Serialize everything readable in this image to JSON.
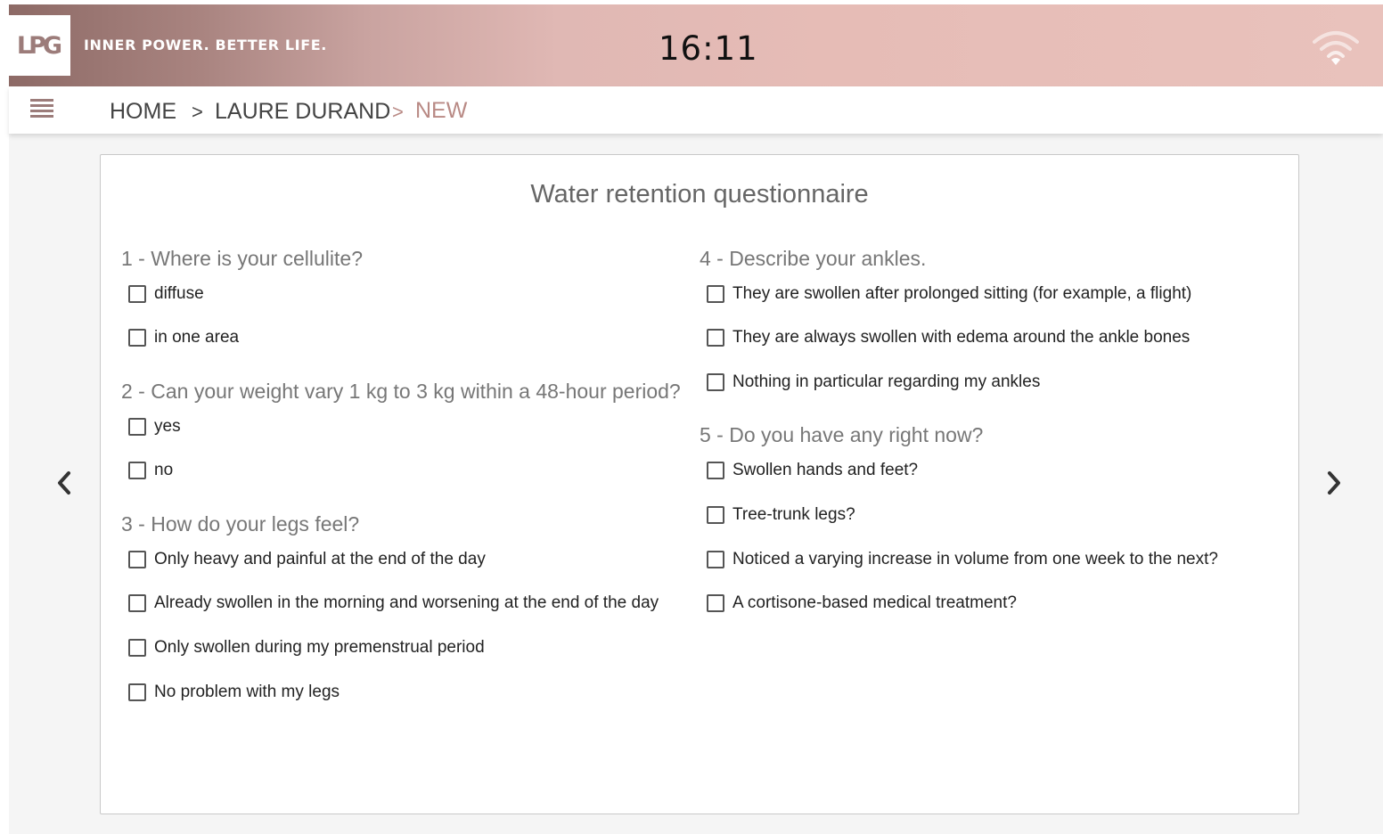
{
  "header": {
    "logo": "LPG",
    "tagline": "INNER POWER. BETTER LIFE.",
    "time": "16:11",
    "wifi_icon": "wifi-icon",
    "colors": {
      "brand": "#9c7c7a",
      "accent": "#b98a85"
    }
  },
  "breadcrumb": {
    "home": "HOME",
    "sep": ">",
    "client": "LAURE DURAND",
    "current": "NEW"
  },
  "questionnaire": {
    "title": "Water retention questionnaire",
    "q1": {
      "title": "1 - Where is your cellulite?",
      "options": [
        "diffuse",
        "in one area"
      ]
    },
    "q2": {
      "title": "2 - Can your weight vary 1 kg to 3 kg within a 48-hour period?",
      "options": [
        "yes",
        "no"
      ]
    },
    "q3": {
      "title": "3 - How do your legs feel?",
      "options": [
        "Only heavy and painful at the end of the day",
        "Already swollen in the morning and worsening at the end of the day",
        "Only swollen during my premenstrual period",
        "No problem with my legs"
      ]
    },
    "q4": {
      "title": "4 - Describe your ankles.",
      "options": [
        "They are swollen after prolonged sitting (for example, a flight)",
        "They are always swollen with edema around the ankle bones",
        "Nothing in particular regarding my ankles"
      ]
    },
    "q5": {
      "title": "5 - Do you have any right now?",
      "options": [
        "Swollen hands and feet?",
        "Tree-trunk legs?",
        "Noticed a varying increase in volume from one week to the next?",
        "A cortisone-based medical treatment?"
      ]
    }
  }
}
